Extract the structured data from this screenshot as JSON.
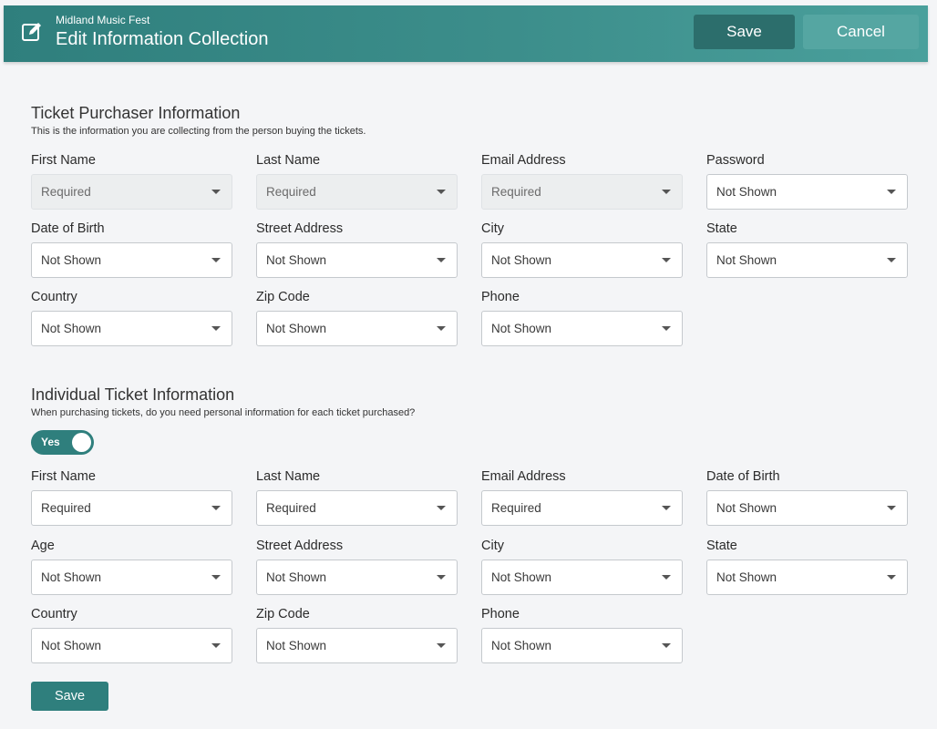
{
  "header": {
    "app_name": "Midland Music Fest",
    "title": "Edit Information Collection",
    "save_label": "Save",
    "cancel_label": "Cancel",
    "color": "#3c8e8b"
  },
  "purchaser": {
    "title": "Ticket Purchaser Information",
    "description": "This is the information you are collecting from the person buying the tickets.",
    "fields": [
      {
        "label": "First Name",
        "value": "Required",
        "disabled": true
      },
      {
        "label": "Last Name",
        "value": "Required",
        "disabled": true
      },
      {
        "label": "Email Address",
        "value": "Required",
        "disabled": true
      },
      {
        "label": "Password",
        "value": "Not Shown",
        "disabled": false
      },
      {
        "label": "Date of Birth",
        "value": "Not Shown",
        "disabled": false
      },
      {
        "label": "Street Address",
        "value": "Not Shown",
        "disabled": false
      },
      {
        "label": "City",
        "value": "Not Shown",
        "disabled": false
      },
      {
        "label": "State",
        "value": "Not Shown",
        "disabled": false
      },
      {
        "label": "Country",
        "value": "Not Shown",
        "disabled": false
      },
      {
        "label": "Zip Code",
        "value": "Not Shown",
        "disabled": false
      },
      {
        "label": "Phone",
        "value": "Not Shown",
        "disabled": false
      }
    ]
  },
  "individual": {
    "title": "Individual Ticket Information",
    "description": "When purchasing tickets, do you need personal information for each ticket purchased?",
    "toggle_label": "Yes",
    "toggle_on": true,
    "fields": [
      {
        "label": "First Name",
        "value": "Required",
        "disabled": false
      },
      {
        "label": "Last Name",
        "value": "Required",
        "disabled": false
      },
      {
        "label": "Email Address",
        "value": "Required",
        "disabled": false
      },
      {
        "label": "Date of Birth",
        "value": "Not Shown",
        "disabled": false
      },
      {
        "label": "Age",
        "value": "Not Shown",
        "disabled": false
      },
      {
        "label": "Street Address",
        "value": "Not Shown",
        "disabled": false
      },
      {
        "label": "City",
        "value": "Not Shown",
        "disabled": false
      },
      {
        "label": "State",
        "value": "Not Shown",
        "disabled": false
      },
      {
        "label": "Country",
        "value": "Not Shown",
        "disabled": false
      },
      {
        "label": "Zip Code",
        "value": "Not Shown",
        "disabled": false
      },
      {
        "label": "Phone",
        "value": "Not Shown",
        "disabled": false
      }
    ]
  },
  "footer": {
    "save_label": "Save"
  }
}
